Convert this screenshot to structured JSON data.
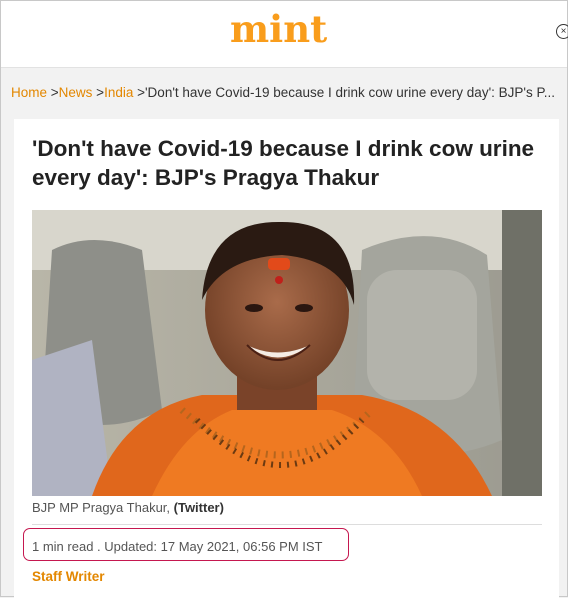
{
  "header": {
    "logo_text": "mint",
    "close_glyph": "×"
  },
  "breadcrumb": {
    "items": [
      {
        "label": "Home",
        "sep": " >"
      },
      {
        "label": "News",
        "sep": " >"
      },
      {
        "label": "India",
        "sep": " >"
      }
    ],
    "current": "'Don't have Covid-19 because I drink cow urine every day': BJP's P..."
  },
  "article": {
    "title": "'Don't have Covid-19 because I drink cow urine every day': BJP's Pragya Thakur",
    "caption_text": "BJP MP Pragya Thakur, ",
    "caption_credit": "(Twitter)",
    "meta": "1 min read . Updated: 17 May 2021, 06:56 PM IST",
    "author": "Staff Writer"
  },
  "colors": {
    "brand": "#f99d1c",
    "link": "#e38700",
    "highlight": "#c5174f"
  }
}
